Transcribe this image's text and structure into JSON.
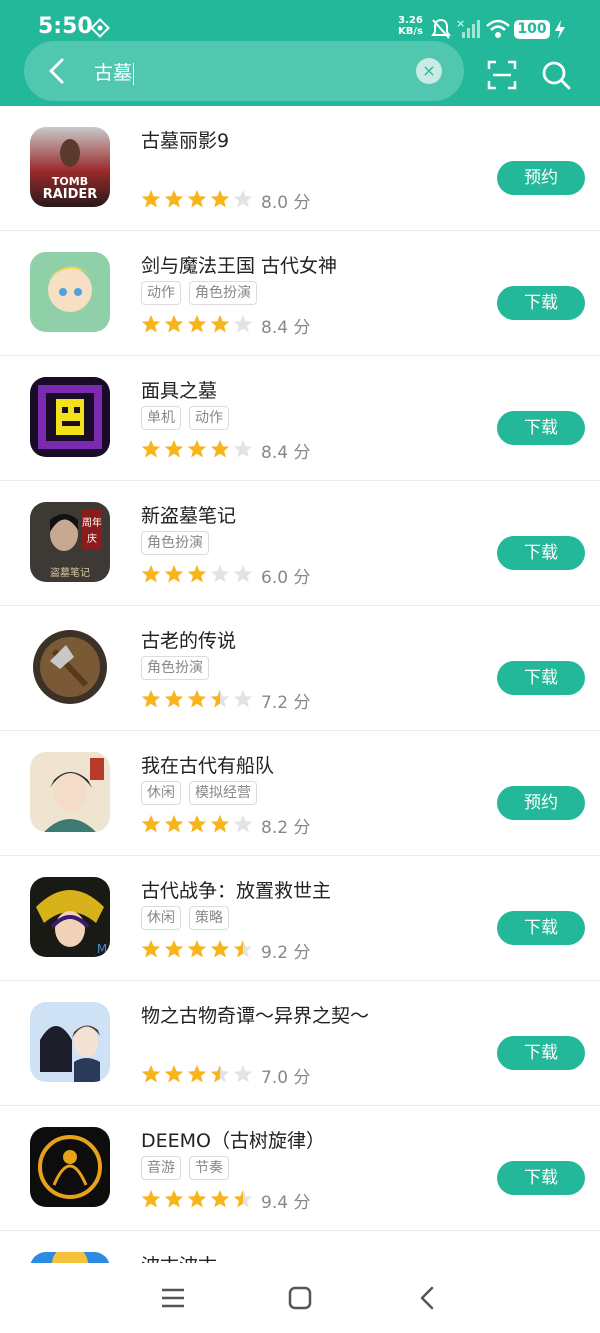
{
  "status_bar": {
    "time": "5:50",
    "net_speed": "3.26",
    "net_unit": "KB/s",
    "battery": "100",
    "icons": [
      "vpn-icon",
      "mute-icon",
      "signal-off-icon",
      "wifi-icon",
      "charging-icon"
    ]
  },
  "search": {
    "query": "古墓",
    "clear_label": "×"
  },
  "colors": {
    "accent": "#22b899",
    "star_on": "#f8b51b",
    "star_off": "#e3e3e3"
  },
  "results": [
    {
      "name": "古墓丽影9",
      "tags": [],
      "rating": 4,
      "score": "8.0 分",
      "action": "预约"
    },
    {
      "name": "剑与魔法王国 古代女神",
      "tags": [
        "动作",
        "角色扮演"
      ],
      "rating": 4,
      "score": "8.4 分",
      "action": "下载"
    },
    {
      "name": "面具之墓",
      "tags": [
        "单机",
        "动作"
      ],
      "rating": 4,
      "score": "8.4 分",
      "action": "下载"
    },
    {
      "name": "新盗墓笔记",
      "tags": [
        "角色扮演"
      ],
      "rating": 3,
      "score": "6.0 分",
      "action": "下载"
    },
    {
      "name": "古老的传说",
      "tags": [
        "角色扮演"
      ],
      "rating": 3.5,
      "score": "7.2 分",
      "action": "下载"
    },
    {
      "name": "我在古代有船队",
      "tags": [
        "休闲",
        "模拟经营"
      ],
      "rating": 4,
      "score": "8.2 分",
      "action": "预约"
    },
    {
      "name": "古代战争：放置救世主",
      "tags": [
        "休闲",
        "策略"
      ],
      "rating": 4.5,
      "score": "9.2 分",
      "action": "下载"
    },
    {
      "name": "物之古物奇谭～异界之契～",
      "tags": [],
      "rating": 3.5,
      "score": "7.0 分",
      "action": "下载"
    },
    {
      "name": "DEEMO（古树旋律）",
      "tags": [
        "音游",
        "节奏"
      ],
      "rating": 4.5,
      "score": "9.4 分",
      "action": "下载"
    },
    {
      "name": "波古波古",
      "tags": [],
      "rating": null,
      "score": "",
      "action": ""
    }
  ],
  "nav_bar": [
    "menu-icon",
    "home-icon",
    "back-icon"
  ]
}
